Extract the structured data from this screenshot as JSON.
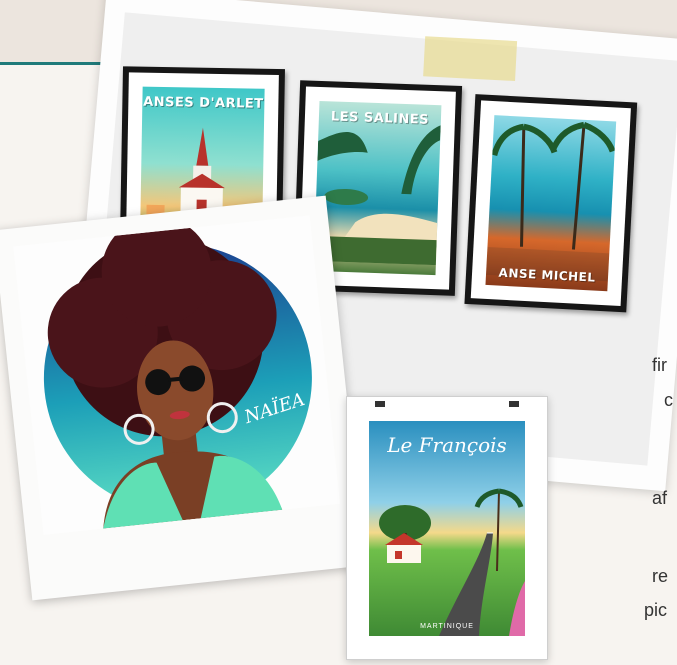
{
  "posters": [
    {
      "title": "ANSES D'ARLET"
    },
    {
      "title": "LES SALINES"
    },
    {
      "title": "ANSE MICHEL"
    }
  ],
  "portrait": {
    "signature": "NAÏEA"
  },
  "small_poster": {
    "title": "Le François",
    "subtitle": "MARTINIQUE"
  },
  "side_text": [
    "fir",
    "c",
    "af",
    "re",
    "pic"
  ],
  "colors": {
    "teal": "#1f7a7a",
    "band": "#ece5de"
  }
}
